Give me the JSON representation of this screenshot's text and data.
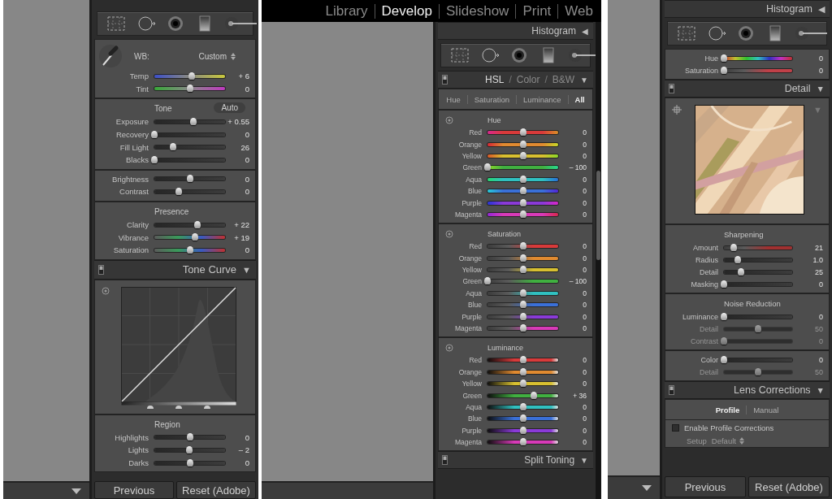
{
  "columns": [
    {
      "filmstrip_toggle": true,
      "sections": [
        {
          "kind": "tools"
        },
        {
          "kind": "wb",
          "label": "WB:",
          "value": "Custom",
          "rows": [
            {
              "label": "Temp",
              "kind": "temp",
              "level": 0.53,
              "value": "+ 6"
            },
            {
              "label": "Tint",
              "kind": "tint",
              "level": 0.5,
              "value": "0"
            }
          ]
        },
        {
          "kind": "group",
          "title": "Tone",
          "button": "Auto",
          "rows": [
            {
              "label": "Exposure",
              "kind": "plain",
              "level": 0.55,
              "value": "+ 0.55"
            },
            {
              "label": "Recovery",
              "kind": "plain",
              "level": 0,
              "value": "0"
            },
            {
              "label": "Fill Light",
              "kind": "plain",
              "level": 0.26,
              "value": "26"
            },
            {
              "label": "Blacks",
              "kind": "plain",
              "level": 0,
              "value": "0"
            }
          ]
        },
        {
          "kind": "group",
          "rows": [
            {
              "label": "Brightness",
              "kind": "plain",
              "level": 0.5,
              "value": "0"
            },
            {
              "label": "Contrast",
              "kind": "plain",
              "level": 0.35,
              "value": "0"
            }
          ]
        },
        {
          "kind": "group",
          "title": "Presence",
          "rows": [
            {
              "label": "Clarity",
              "kind": "plain",
              "level": 0.61,
              "value": "+ 22"
            },
            {
              "label": "Vibrance",
              "kind": "vivid",
              "level": 0.57,
              "value": "+ 19"
            },
            {
              "label": "Saturation",
              "kind": "vivid",
              "level": 0.5,
              "value": "0"
            }
          ]
        },
        {
          "kind": "header",
          "title": "Tone Curve",
          "toggle": true,
          "arrow": "▼"
        },
        {
          "kind": "curve"
        },
        {
          "kind": "group",
          "title": "Region",
          "rows": [
            {
              "label": "Highlights",
              "kind": "plain",
              "level": 0.5,
              "value": "0"
            },
            {
              "label": "Lights",
              "kind": "plain",
              "level": 0.49,
              "value": "– 2"
            },
            {
              "label": "Darks",
              "kind": "plain",
              "level": 0.5,
              "value": "0"
            }
          ]
        },
        {
          "kind": "buttons",
          "items": [
            "Previous",
            "Reset (Adobe)"
          ]
        }
      ]
    },
    {
      "modules": [
        {
          "label": "Library",
          "selected": false
        },
        {
          "label": "Develop",
          "selected": true
        },
        {
          "label": "Slideshow",
          "selected": false
        },
        {
          "label": "Print",
          "selected": false
        },
        {
          "label": "Web",
          "selected": false
        }
      ],
      "scrollbar": true,
      "sections": [
        {
          "kind": "header",
          "title": "Histogram",
          "arrow": "◀"
        },
        {
          "kind": "tools"
        },
        {
          "kind": "header",
          "items": [
            {
              "label": "HSL",
              "selected": true
            },
            {
              "label": "Color",
              "selected": false
            },
            {
              "label": "B&W",
              "selected": false
            }
          ],
          "separators": [
            "/",
            "/"
          ],
          "toggle": true,
          "arrow": "▼"
        },
        {
          "kind": "tabs",
          "items": [
            {
              "label": "Hue",
              "selected": false
            },
            {
              "label": "Saturation",
              "selected": false
            },
            {
              "label": "Luminance",
              "selected": false
            },
            {
              "label": "All",
              "selected": true
            }
          ]
        },
        {
          "kind": "group",
          "title": "Hue",
          "target": true,
          "rows": [
            {
              "label": "Red",
              "kind": "hue",
              "color": "#d83a3a",
              "level": 0.5,
              "value": "0"
            },
            {
              "label": "Orange",
              "kind": "hue",
              "color": "#e08a30",
              "level": 0.5,
              "value": "0"
            },
            {
              "label": "Yellow",
              "kind": "hue",
              "color": "#d8c030",
              "level": 0.5,
              "value": "0"
            },
            {
              "label": "Green",
              "kind": "hue",
              "color": "#40b040",
              "level": 0,
              "value": "– 100"
            },
            {
              "label": "Aqua",
              "kind": "hue",
              "color": "#30c0c0",
              "level": 0.5,
              "value": "0"
            },
            {
              "label": "Blue",
              "kind": "hue",
              "color": "#3a70d8",
              "level": 0.5,
              "value": "0"
            },
            {
              "label": "Purple",
              "kind": "hue",
              "color": "#8a3ad8",
              "level": 0.5,
              "value": "0"
            },
            {
              "label": "Magenta",
              "kind": "hue",
              "color": "#d83ab8",
              "level": 0.5,
              "value": "0"
            }
          ]
        },
        {
          "kind": "group",
          "title": "Saturation",
          "target": true,
          "rows": [
            {
              "label": "Red",
              "kind": "sat",
              "color": "#d83a3a",
              "level": 0.5,
              "value": "0"
            },
            {
              "label": "Orange",
              "kind": "sat",
              "color": "#e08a30",
              "level": 0.5,
              "value": "0"
            },
            {
              "label": "Yellow",
              "kind": "sat",
              "color": "#d8c030",
              "level": 0.5,
              "value": "0"
            },
            {
              "label": "Green",
              "kind": "sat",
              "color": "#40b040",
              "level": 0,
              "value": "– 100"
            },
            {
              "label": "Aqua",
              "kind": "sat",
              "color": "#30c0c0",
              "level": 0.5,
              "value": "0"
            },
            {
              "label": "Blue",
              "kind": "sat",
              "color": "#3a70d8",
              "level": 0.5,
              "value": "0"
            },
            {
              "label": "Purple",
              "kind": "sat",
              "color": "#8a3ad8",
              "level": 0.5,
              "value": "0"
            },
            {
              "label": "Magenta",
              "kind": "sat",
              "color": "#d83ab8",
              "level": 0.5,
              "value": "0"
            }
          ]
        },
        {
          "kind": "group",
          "title": "Luminance",
          "target": true,
          "rows": [
            {
              "label": "Red",
              "kind": "lum",
              "color": "#d83a3a",
              "level": 0.5,
              "value": "0"
            },
            {
              "label": "Orange",
              "kind": "lum",
              "color": "#e08a30",
              "level": 0.5,
              "value": "0"
            },
            {
              "label": "Yellow",
              "kind": "lum",
              "color": "#d8c030",
              "level": 0.5,
              "value": "0"
            },
            {
              "label": "Green",
              "kind": "lum",
              "color": "#40b040",
              "level": 0.66,
              "value": "+ 36"
            },
            {
              "label": "Aqua",
              "kind": "lum",
              "color": "#30c0c0",
              "level": 0.5,
              "value": "0"
            },
            {
              "label": "Blue",
              "kind": "lum",
              "color": "#3a70d8",
              "level": 0.5,
              "value": "0"
            },
            {
              "label": "Purple",
              "kind": "lum",
              "color": "#8a3ad8",
              "level": 0.5,
              "value": "0"
            },
            {
              "label": "Magenta",
              "kind": "lum",
              "color": "#d83ab8",
              "level": 0.5,
              "value": "0"
            }
          ]
        },
        {
          "kind": "header",
          "title": "Split Toning",
          "toggle": true,
          "arrow": "▼"
        }
      ]
    },
    {
      "filmstrip_toggle": true,
      "sections": [
        {
          "kind": "header",
          "title": "Histogram",
          "arrow": "◀"
        },
        {
          "kind": "tools"
        },
        {
          "kind": "group",
          "rows": [
            {
              "label": "Hue",
              "kind": "rainbow",
              "level": 0,
              "value": "0"
            },
            {
              "label": "Saturation",
              "kind": "sat",
              "color": "#c04048",
              "level": 0,
              "value": "0"
            }
          ]
        },
        {
          "kind": "header",
          "title": "Detail",
          "toggle": true,
          "arrow": "▼"
        },
        {
          "kind": "preview",
          "arrow": "▼"
        },
        {
          "kind": "group",
          "title": "Sharpening",
          "rows": [
            {
              "label": "Amount",
              "kind": "sat",
              "color": "#a03030",
              "level": 0.14,
              "value": "21"
            },
            {
              "label": "Radius",
              "kind": "plain",
              "level": 0.2,
              "value": "1.0"
            },
            {
              "label": "Detail",
              "kind": "plain",
              "level": 0.25,
              "value": "25"
            },
            {
              "label": "Masking",
              "kind": "plain",
              "level": 0,
              "value": "0"
            }
          ]
        },
        {
          "kind": "group",
          "title": "Noise Reduction",
          "rows": [
            {
              "label": "Luminance",
              "kind": "plain",
              "level": 0,
              "value": "0",
              "disabled": false
            },
            {
              "label": "Detail",
              "kind": "plain",
              "level": 0.5,
              "value": "50",
              "disabled": true
            },
            {
              "label": "Contrast",
              "kind": "plain",
              "level": 0,
              "value": "0",
              "disabled": true
            }
          ]
        },
        {
          "kind": "group",
          "rows": [
            {
              "label": "Color",
              "kind": "plain",
              "level": 0,
              "value": "0",
              "disabled": false
            },
            {
              "label": "Detail",
              "kind": "plain",
              "level": 0.5,
              "value": "50",
              "disabled": true
            }
          ]
        },
        {
          "kind": "header",
          "title": "Lens Corrections",
          "toggle": true,
          "arrow": "▼"
        },
        {
          "kind": "tabs",
          "items": [
            {
              "label": "Profile",
              "selected": true
            },
            {
              "label": "Manual",
              "selected": false
            }
          ]
        },
        {
          "kind": "checkbox",
          "label": "Enable Profile Corrections",
          "checked": false
        },
        {
          "kind": "select",
          "label": "Setup",
          "value": "Default"
        },
        {
          "kind": "buttons",
          "items": [
            "Previous",
            "Reset (Adobe)"
          ]
        }
      ]
    }
  ]
}
